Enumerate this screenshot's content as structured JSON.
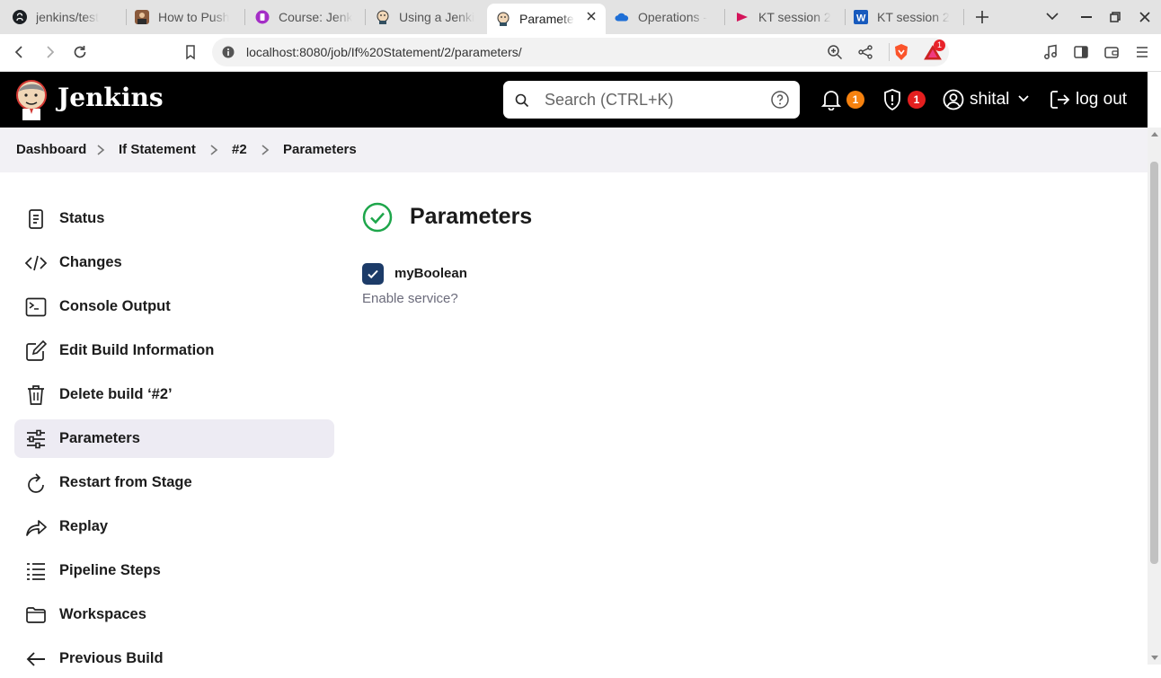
{
  "browser": {
    "tabs": [
      {
        "label": "jenkins/test",
        "icon": "github-icon"
      },
      {
        "label": "How to Push",
        "icon": "person-avatar-icon"
      },
      {
        "label": "Course: Jenk",
        "icon": "course-icon"
      },
      {
        "label": "Using a Jenki",
        "icon": "jenkins-icon"
      },
      {
        "label": "Paramete",
        "icon": "jenkins-icon",
        "active": true
      },
      {
        "label": "Operations -",
        "icon": "onedrive-icon"
      },
      {
        "label": "KT session 2",
        "icon": "stream-icon"
      },
      {
        "label": "KT session 2",
        "icon": "word-icon"
      }
    ],
    "url": "localhost:8080/job/If%20Statement/2/parameters/",
    "brave_badge": "1"
  },
  "header": {
    "brand": "Jenkins",
    "search_placeholder": "Search (CTRL+K)",
    "notifications_count": "1",
    "security_count": "1",
    "user": "shital",
    "logout": "log out",
    "colors": {
      "header_bg": "#000000",
      "notif_badge": "#f7820f",
      "security_badge": "#e41f1f"
    }
  },
  "breadcrumbs": [
    "Dashboard",
    "If Statement",
    "#2",
    "Parameters"
  ],
  "sidebar": {
    "items": [
      {
        "label": "Status",
        "icon": "notepad-icon"
      },
      {
        "label": "Changes",
        "icon": "code-icon"
      },
      {
        "label": "Console Output",
        "icon": "terminal-icon"
      },
      {
        "label": "Edit Build Information",
        "icon": "edit-icon"
      },
      {
        "label": "Delete build ‘#2’",
        "icon": "trash-icon"
      },
      {
        "label": "Parameters",
        "icon": "sliders-icon",
        "selected": true
      },
      {
        "label": "Restart from Stage",
        "icon": "restart-icon"
      },
      {
        "label": "Replay",
        "icon": "replay-icon"
      },
      {
        "label": "Pipeline Steps",
        "icon": "list-icon"
      },
      {
        "label": "Workspaces",
        "icon": "folder-icon"
      },
      {
        "label": "Previous Build",
        "icon": "arrow-left-icon"
      }
    ]
  },
  "main": {
    "title": "Parameters",
    "status_color": "#1ea64b",
    "param": {
      "name": "myBoolean",
      "checked": true,
      "description": "Enable service?"
    }
  }
}
